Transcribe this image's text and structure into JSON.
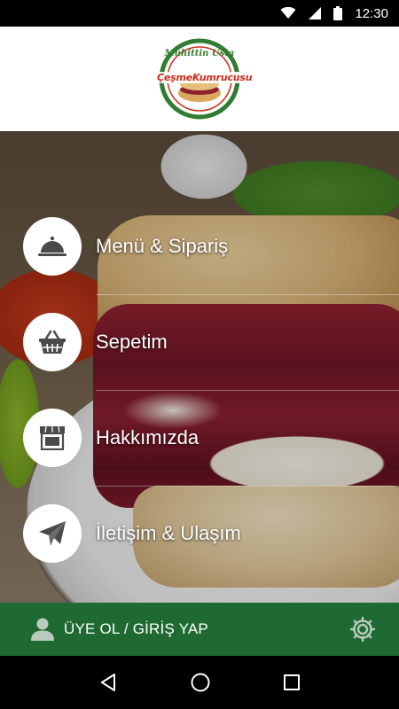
{
  "status_bar": {
    "time": "12:30"
  },
  "header": {
    "logo_script": "Muhittin Usta",
    "logo_text": "ÇeşmeKumrucusu"
  },
  "menu": {
    "items": [
      {
        "label": "Menü & Sipariş",
        "icon": "cloche-icon"
      },
      {
        "label": "Sepetim",
        "icon": "basket-icon"
      },
      {
        "label": "Hakkımızda",
        "icon": "store-icon"
      },
      {
        "label": "İletişim & Ulaşım",
        "icon": "paper-plane-icon"
      }
    ]
  },
  "bottom_bar": {
    "login_label": "ÜYE OL / GİRİŞ YAP",
    "user_icon": "user-icon",
    "settings_icon": "gear-icon"
  },
  "nav_bar": {
    "back_icon": "back-icon",
    "home_icon": "home-icon",
    "recents_icon": "recents-icon"
  },
  "colors": {
    "accent_green": "#1f6a33",
    "icon_gray": "#4a4a4a",
    "logo_red": "#c8301e"
  }
}
